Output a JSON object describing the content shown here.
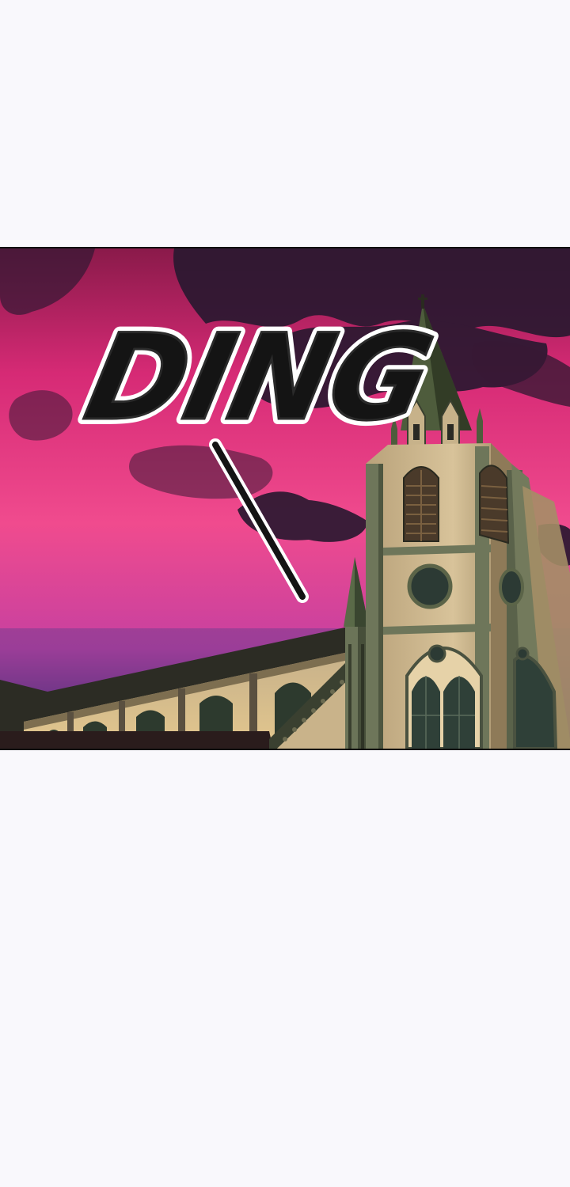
{
  "panel": {
    "sfx": "DING",
    "colors": {
      "page_background": "#f9f8fc",
      "sky_magenta": "#e0307e",
      "sky_pink": "#f04a8e",
      "cloud_dark": "#2a1a30",
      "building_beige": "#c9b692",
      "building_shadow": "#6a6a4e",
      "roof_green": "#3d4a30"
    }
  }
}
